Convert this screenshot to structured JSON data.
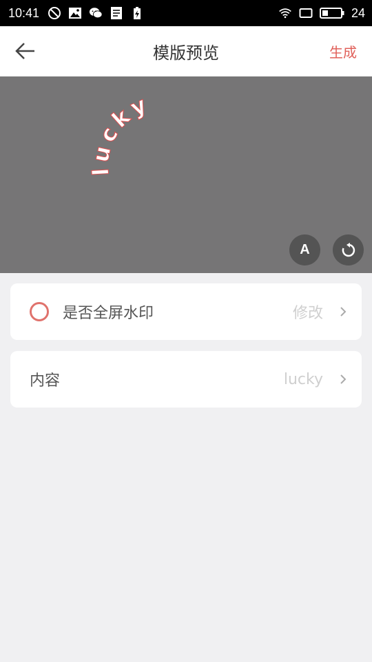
{
  "status_bar": {
    "time": "10:41",
    "battery_level": "24",
    "icons": [
      "do-not-disturb-icon",
      "image-icon",
      "wechat-icon",
      "document-icon",
      "battery-saver-icon",
      "wifi-icon",
      "screen-icon",
      "battery-icon"
    ]
  },
  "nav": {
    "title": "模版预览",
    "action_label": "生成"
  },
  "preview": {
    "watermark_text": "lucky",
    "font_button_label": "A",
    "background_color": "#767576"
  },
  "settings": {
    "fullscreen": {
      "label": "是否全屏水印",
      "value": "修改",
      "checked": false
    },
    "content": {
      "label": "内容",
      "value": "lucky"
    }
  },
  "colors": {
    "accent": "#e0605a"
  }
}
